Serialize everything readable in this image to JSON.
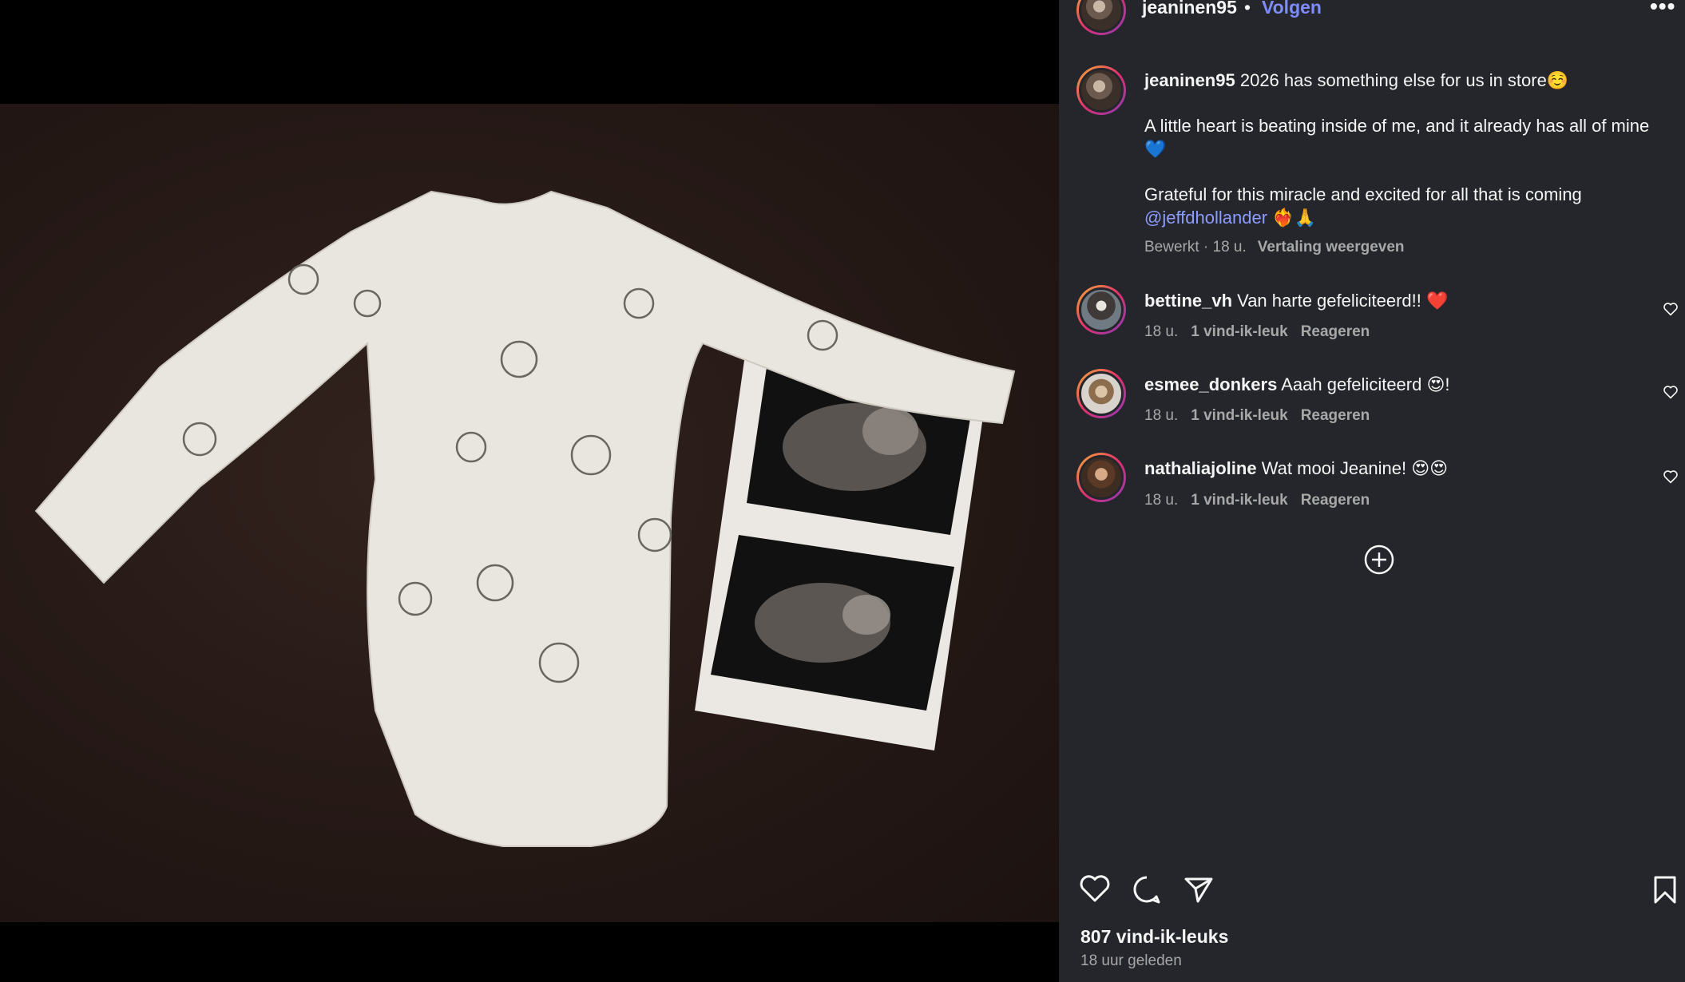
{
  "post": {
    "username": "jeaninen95",
    "separator": "•",
    "follow_label": "Volgen",
    "more_label": "•••"
  },
  "caption": {
    "username": "jeaninen95",
    "line1": "2026 has something else for us in store☺️",
    "line2": "A little heart is beating inside of me, and it already has all of mine 💙",
    "line3": "Grateful for this miracle and excited for all that is coming",
    "mention": "@jeffdhollander",
    "mention_emoji": "❤️‍🔥🙏",
    "meta_time": "Bewerkt · 18 u.",
    "translate_label": "Vertaling weergeven"
  },
  "comments": [
    {
      "username": "bettine_vh",
      "text": "Van harte gefeliciteerd!! ❤️",
      "time": "18 u.",
      "likes": "1 vind-ik-leuk",
      "reply": "Reageren"
    },
    {
      "username": "esmee_donkers",
      "text": "Aaah gefeliciteerd 😍!",
      "time": "18 u.",
      "likes": "1 vind-ik-leuk",
      "reply": "Reageren"
    },
    {
      "username": "nathaliajoline",
      "text": "Wat mooi Jeanine! 😍😍",
      "time": "18 u.",
      "likes": "1 vind-ik-leuk",
      "reply": "Reageren"
    }
  ],
  "footer": {
    "likes_count": "807 vind-ik-leuks",
    "posted_ago": "18 uur geleden"
  },
  "icons": {
    "like": "heart-icon",
    "comment": "speech-bubble-icon",
    "share": "paper-plane-icon",
    "save": "bookmark-icon",
    "add_comment": "plus-circle-icon"
  },
  "colors": {
    "panel_bg": "#25262b",
    "link_blue": "#7f8cff",
    "muted": "#a8a8a8"
  }
}
